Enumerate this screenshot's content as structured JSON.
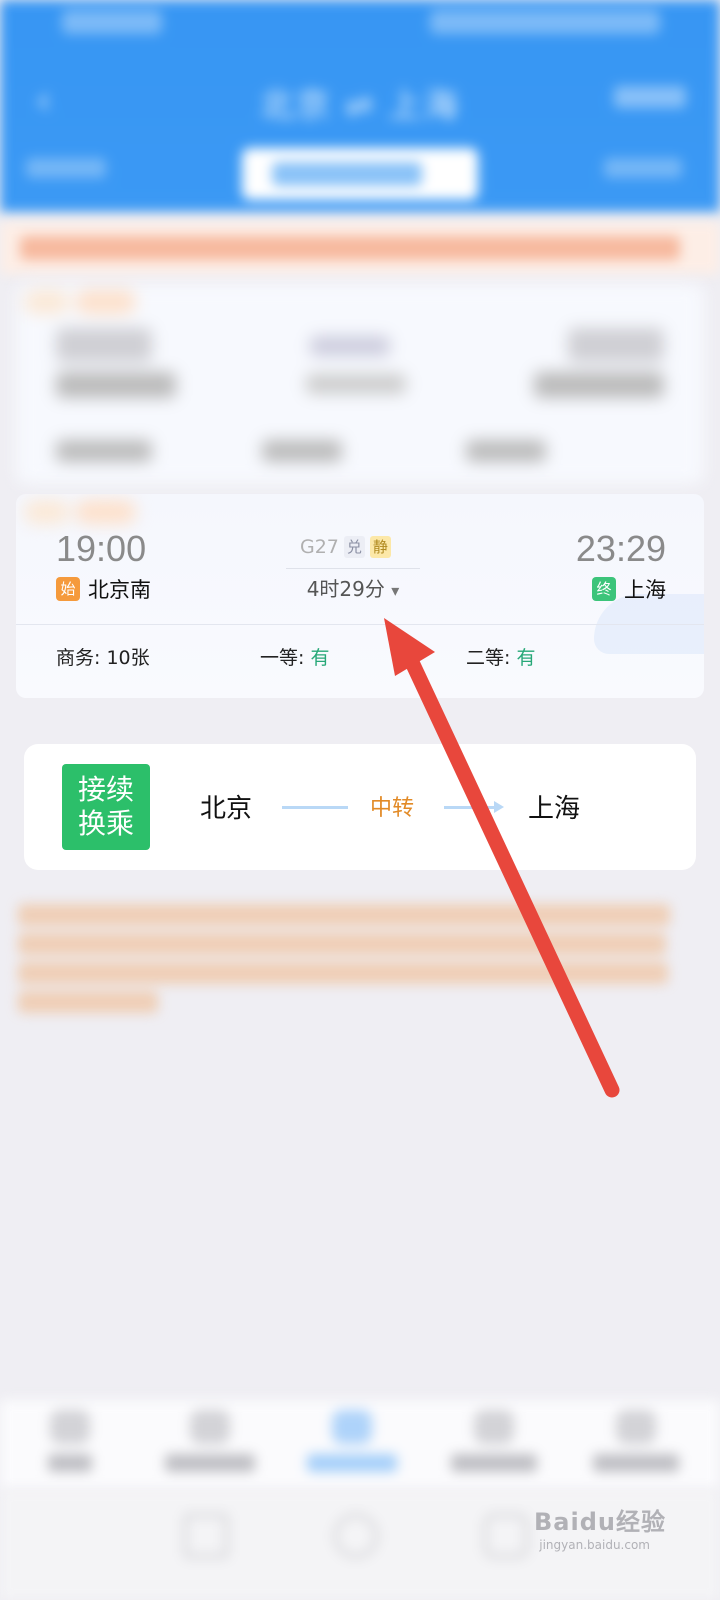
{
  "header": {
    "route_title": "北京 ⇌ 上海",
    "back_glyph": "‹"
  },
  "train": {
    "depart_time": "19:00",
    "depart_badge": "始",
    "depart_station": "北京南",
    "train_no": "G27",
    "tag_dui": "兑",
    "tag_jing": "静",
    "duration": "4时29分",
    "duration_caret": "▾",
    "arrive_time": "23:29",
    "arrive_badge": "终",
    "arrive_station": "上海",
    "seats": [
      {
        "label": "商务: ",
        "value": "10张"
      },
      {
        "label": "一等: ",
        "value": "有"
      },
      {
        "label": "二等: ",
        "value": "有"
      }
    ]
  },
  "transfer": {
    "icon_line1": "接续",
    "icon_line2": "换乘",
    "from": "北京",
    "via": "中转",
    "to": "上海"
  },
  "watermark": {
    "brand": "Baidu经验",
    "url": "jingyan.baidu.com"
  },
  "colors": {
    "header_blue": "#3b99f4",
    "available_green": "#27a878",
    "start_badge": "#f59a3c",
    "end_badge": "#3cc47a",
    "transfer_green": "#2cbf6a",
    "via_orange": "#e28a26",
    "annotation_red": "#e8473c"
  }
}
